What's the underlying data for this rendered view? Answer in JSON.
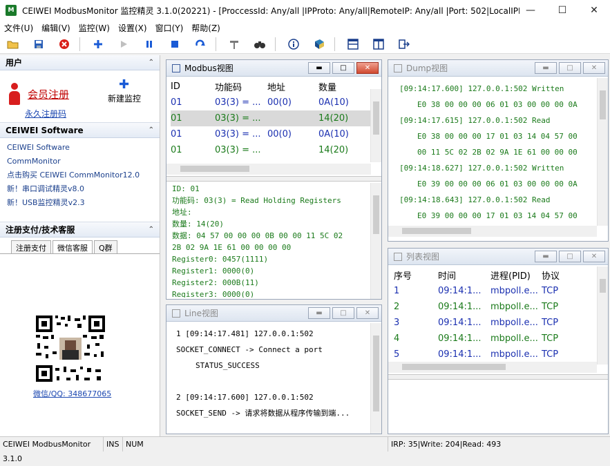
{
  "window": {
    "title": "CEIWEI ModbusMonitor 监控精灵 3.1.0(20221) - [ProccessId: Any/all |IPProto: Any/all|RemoteIP: Any/all |Port: 502|LocalIPIP...",
    "app_icon_text": "M"
  },
  "menu": [
    "文件(U)",
    "编辑(V)",
    "监控(W)",
    "设置(X)",
    "窗口(Y)",
    "帮助(Z)"
  ],
  "left": {
    "user": {
      "header": "用户",
      "member_register": "会员注册",
      "permanent_code": "永久注册码",
      "new_monitor": "新建监控"
    },
    "software": {
      "header": "CEIWEI Software",
      "items": [
        "CEIWEI Software",
        "CommMonitor",
        "点击购买 CEIWEI CommMonitor12.0",
        "新！串口调试精灵v8.0",
        "新！USB监控精灵v2.3"
      ]
    },
    "support": {
      "header": "注册支付/技术客服",
      "tabs": [
        "注册支付",
        "微信客服",
        "Q群"
      ],
      "qr_label": "微信/QQ: 348677065"
    }
  },
  "modbus_view": {
    "title": "Modbus视图",
    "columns": [
      "ID",
      "功能码",
      "地址",
      "数量"
    ],
    "rows": [
      {
        "id": "01",
        "func": "03(3) = ...",
        "addr": "00(0)",
        "qty": "0A(10)",
        "color": "#1a2fb0"
      },
      {
        "id": "01",
        "func": "03(3) = ...",
        "addr": "",
        "qty": "14(20)",
        "color": "#1a7a1a"
      },
      {
        "id": "01",
        "func": "03(3) = ...",
        "addr": "00(0)",
        "qty": "0A(10)",
        "color": "#1a2fb0"
      },
      {
        "id": "01",
        "func": "03(3) = ...",
        "addr": "",
        "qty": "14(20)",
        "color": "#1a7a1a"
      }
    ],
    "details": [
      "ID: 01",
      "功能码: 03(3) = Read Holding Registers",
      "地址:",
      "数量: 14(20)",
      "数据: 04 57 00 00 00 0B 00 00 11 5C 02",
      "2B 02 9A 1E 61 00 00 00 00",
      "Register0: 0457(1111)",
      "Register1: 0000(0)",
      "Register2: 000B(11)",
      "Register3: 0000(0)"
    ]
  },
  "dump_view": {
    "title": "Dump视图",
    "lines": [
      {
        "text": "[09:14:17.600] 127.0.0.1:502 Written",
        "indent": false
      },
      {
        "text": "E0 38 00 00 00 06 01 03 00 00 00 0A",
        "indent": true
      },
      {
        "text": "[09:14:17.615] 127.0.0.1:502 Read",
        "indent": false
      },
      {
        "text": "E0 38 00 00 00 17 01 03 14 04 57 00",
        "indent": true
      },
      {
        "text": "00 11 5C 02 2B 02 9A 1E 61 00 00 00",
        "indent": true
      },
      {
        "text": "[09:14:18.627] 127.0.0.1:502 Written",
        "indent": false
      },
      {
        "text": "E0 39 00 00 00 06 01 03 00 00 00 0A",
        "indent": true
      },
      {
        "text": "[09:14:18.643] 127.0.0.1:502 Read",
        "indent": false
      },
      {
        "text": "E0 39 00 00 00 17 01 03 14 04 57 00",
        "indent": true
      }
    ]
  },
  "line_view": {
    "title": "Line视图",
    "lines": [
      {
        "text": "1 [09:14:17.481] 127.0.0.1:502",
        "indent": false
      },
      {
        "text": "SOCKET_CONNECT -> Connect a port",
        "indent": false
      },
      {
        "text": "STATUS_SUCCESS",
        "indent": true
      },
      {
        "text": "",
        "indent": false
      },
      {
        "text": "2 [09:14:17.600] 127.0.0.1:502",
        "indent": false
      },
      {
        "text": "SOCKET_SEND -> 请求将数据从程序传输到端...",
        "indent": false
      }
    ]
  },
  "list_view": {
    "title": "列表视图",
    "columns": [
      "序号",
      "时间",
      "进程(PID)",
      "协议"
    ],
    "rows": [
      {
        "no": "1",
        "time": "09:14:1...",
        "proc": "mbpoll.e...",
        "proto": "TCP",
        "color": "#1a2fb0"
      },
      {
        "no": "2",
        "time": "09:14:1...",
        "proc": "mbpoll.e...",
        "proto": "TCP",
        "color": "#1a7a1a"
      },
      {
        "no": "3",
        "time": "09:14:1...",
        "proc": "mbpoll.e...",
        "proto": "TCP",
        "color": "#1a2fb0"
      },
      {
        "no": "4",
        "time": "09:14:1...",
        "proc": "mbpoll.e...",
        "proto": "TCP",
        "color": "#1a7a1a"
      },
      {
        "no": "5",
        "time": "09:14:1...",
        "proc": "mbpoll.e...",
        "proto": "TCP",
        "color": "#1a2fb0"
      }
    ]
  },
  "status": {
    "app": "CEIWEI ModbusMonitor 3.1.0",
    "ins": "INS",
    "num": "NUM",
    "counters": "IRP: 35|Write: 204|Read: 493"
  }
}
